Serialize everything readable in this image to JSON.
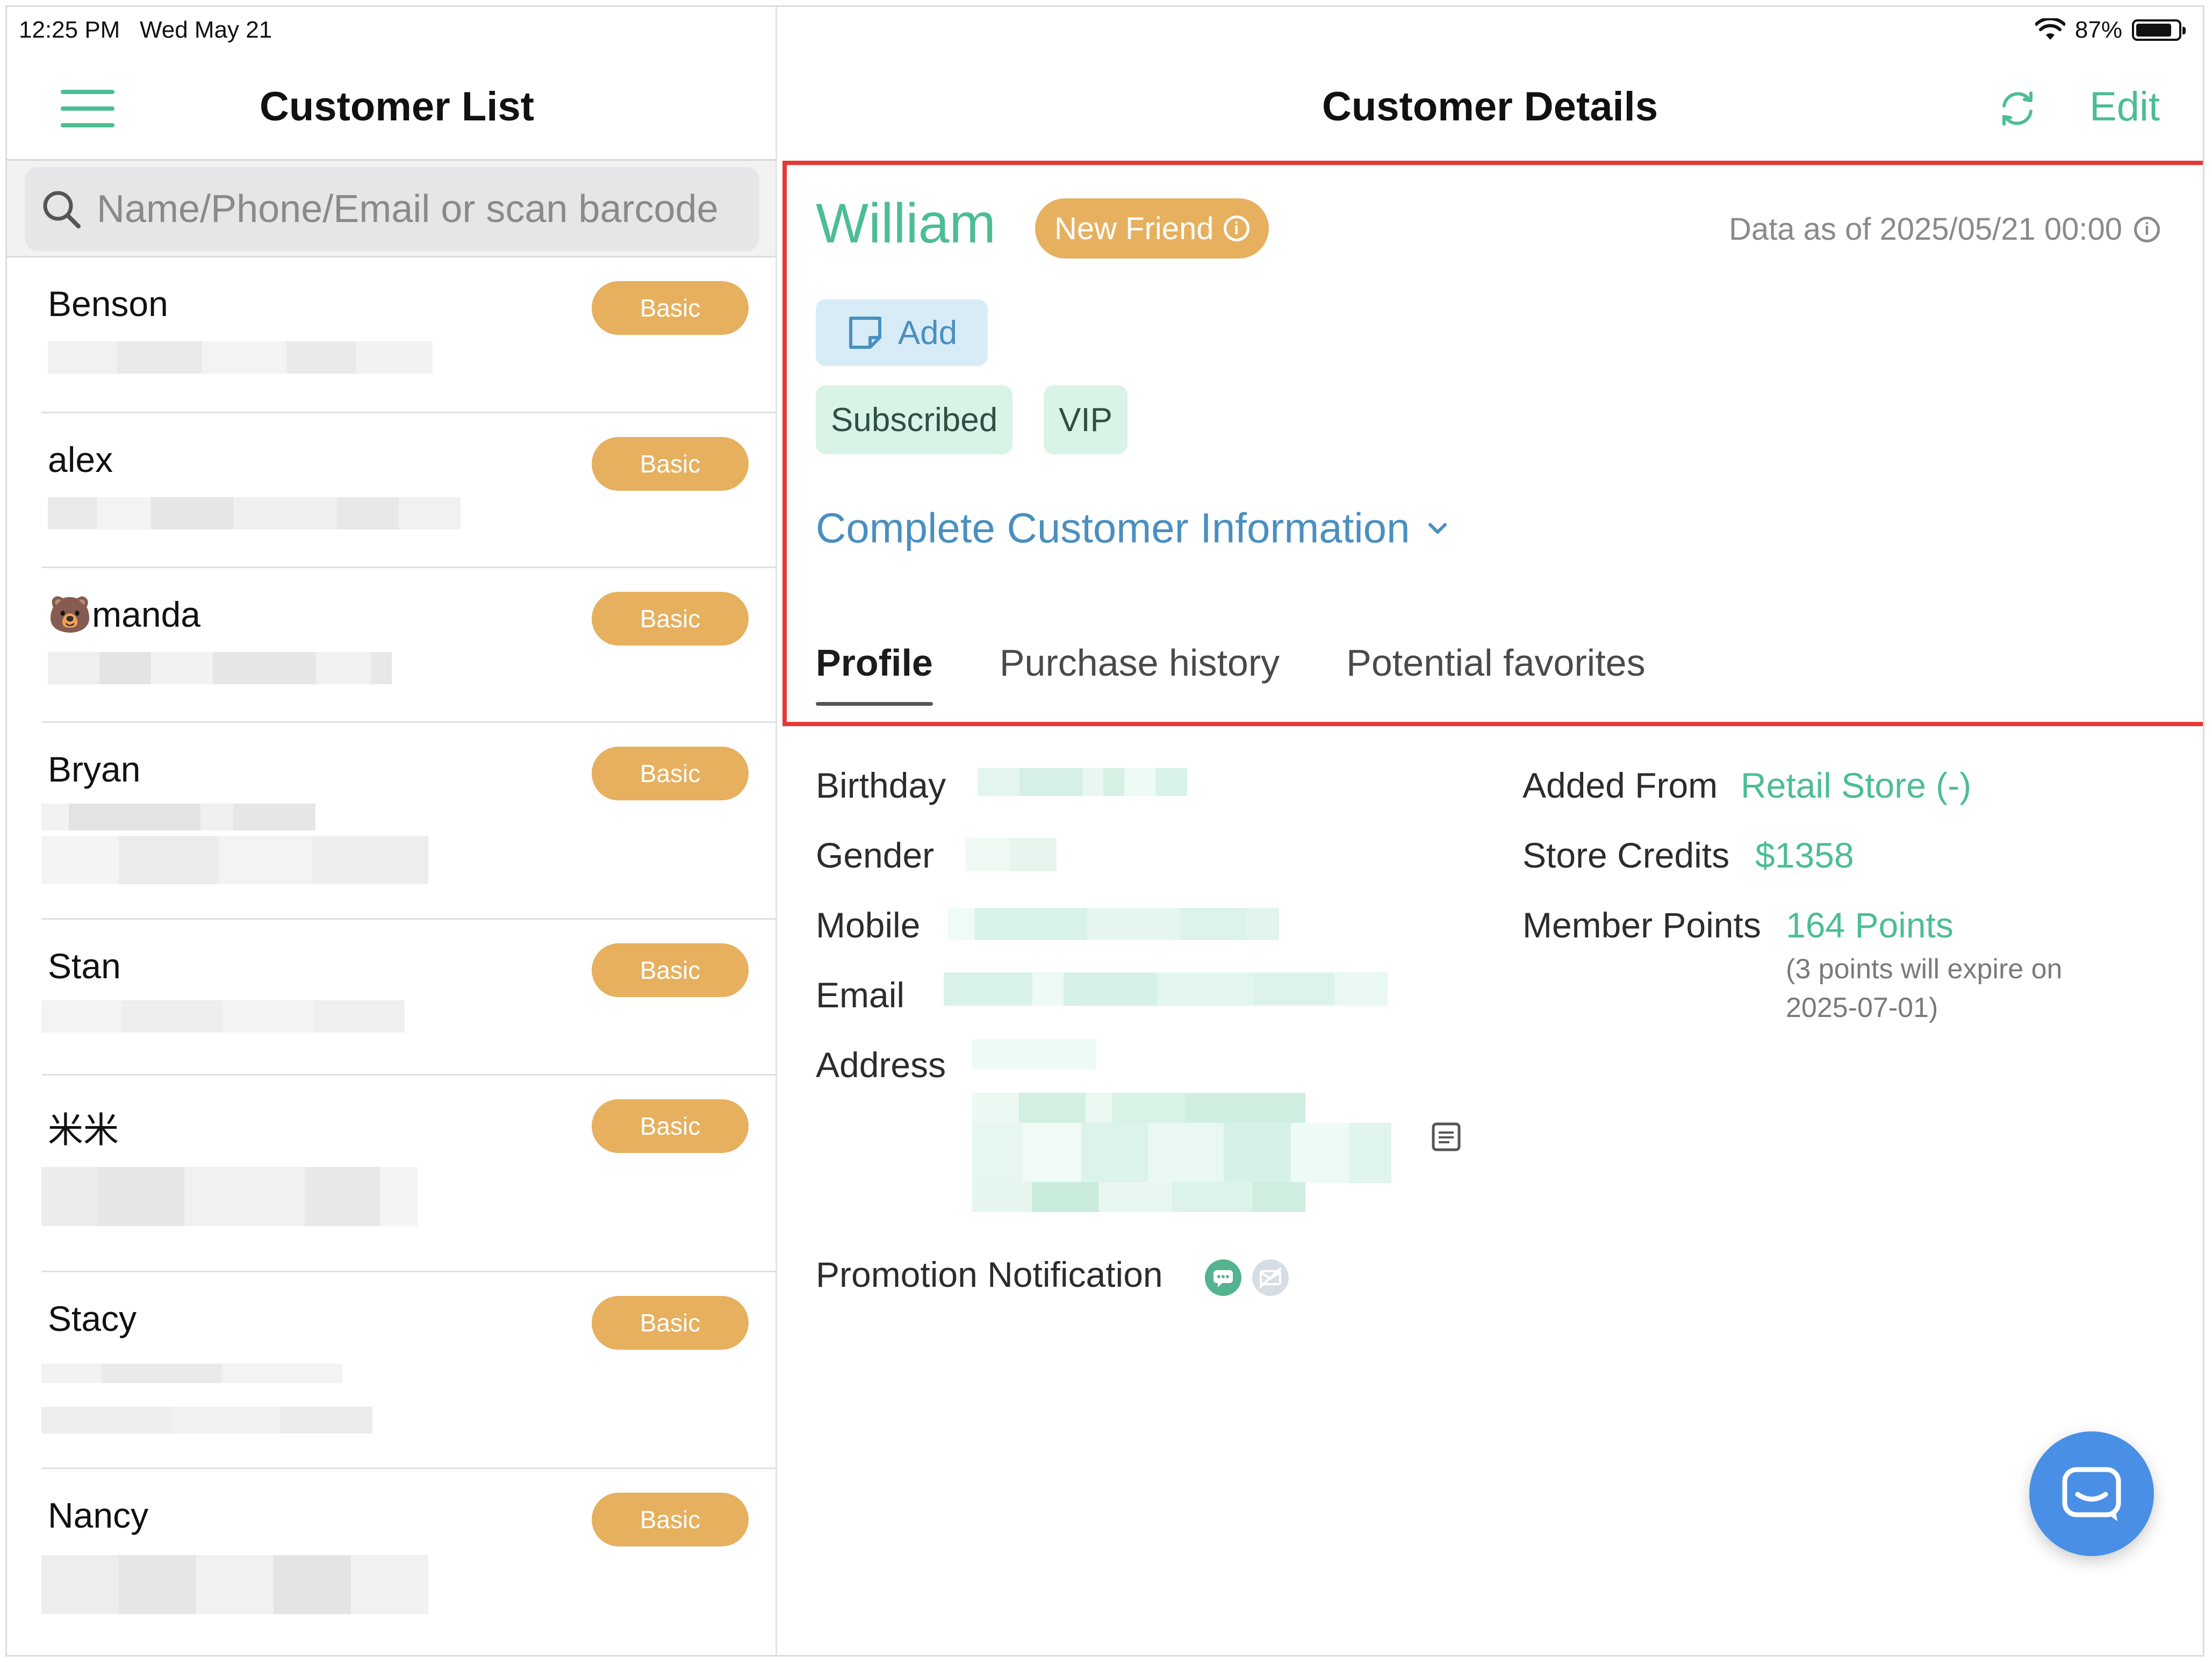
{
  "status_bar": {
    "time": "12:25 PM",
    "date": "Wed May 21",
    "battery": "87%",
    "battery_level": 0.87
  },
  "customer_list": {
    "title": "Customer List",
    "search_placeholder": "Name/Phone/Email or scan barcode",
    "items": [
      {
        "name": "Benson",
        "tier": "Basic"
      },
      {
        "name": "alex",
        "tier": "Basic"
      },
      {
        "name": "🐻manda",
        "tier": "Basic"
      },
      {
        "name": "Bryan",
        "tier": "Basic"
      },
      {
        "name": "Stan",
        "tier": "Basic"
      },
      {
        "name": "米米",
        "tier": "Basic"
      },
      {
        "name": "Stacy",
        "tier": "Basic"
      },
      {
        "name": "Nancy",
        "tier": "Basic"
      }
    ]
  },
  "details": {
    "title": "Customer Details",
    "edit_label": "Edit",
    "customer_name": "William",
    "level_badge": "New Friend",
    "data_as_of": "Data as of 2025/05/21 00:00",
    "add_tag_label": "Add",
    "tags": [
      "Subscribed",
      "VIP"
    ],
    "complete_info_label": "Complete Customer Information",
    "tabs": [
      "Profile",
      "Purchase history",
      "Potential favorites"
    ],
    "active_tab": "Profile",
    "profile": {
      "birthday_label": "Birthday",
      "gender_label": "Gender",
      "mobile_label": "Mobile",
      "email_label": "Email",
      "address_label": "Address",
      "promotion_label": "Promotion Notification",
      "added_from_label": "Added From",
      "added_from_value": "Retail Store (-)",
      "store_credits_label": "Store Credits",
      "store_credits_value": "$1358",
      "member_points_label": "Member Points",
      "member_points_value": "164 Points",
      "points_note_line1": "(3 points will expire on",
      "points_note_line2": "2025-07-01)"
    }
  },
  "colors": {
    "accent_green": "#4cbd94",
    "badge_gold": "#e6b05f",
    "link_blue": "#4a8fc0",
    "highlight_red": "#e53935",
    "fab_blue": "#4a8fe6"
  }
}
